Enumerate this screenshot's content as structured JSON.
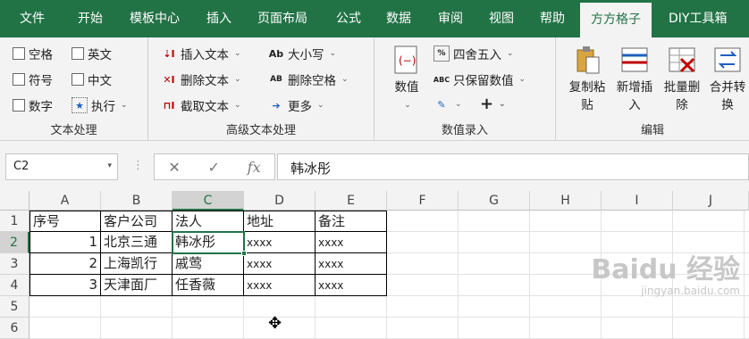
{
  "menu": {
    "tabs": [
      "文件",
      "开始",
      "模板中心",
      "插入",
      "页面布局",
      "公式",
      "数据",
      "审阅",
      "视图",
      "帮助",
      "方方格子",
      "DIY工具箱"
    ],
    "active": "方方格子"
  },
  "ribbon": {
    "text_group": {
      "label": "文本处理",
      "items": [
        "空格",
        "英文",
        "符号",
        "中文",
        "数字",
        "执行"
      ]
    },
    "advanced_group": {
      "label": "高级文本处理",
      "insert": "插入文本",
      "delete": "删除文本",
      "extract": "截取文本",
      "case": "大小写",
      "case_icon": "Ab",
      "del_space": "删除空格",
      "del_space_icon": "AB",
      "more": "更多"
    },
    "value_group": {
      "label": "数值录入",
      "value": "数值",
      "round": "四舍五入",
      "keep_value": "只保留数值",
      "keep_icon": "ABC",
      "plus": "+"
    },
    "edit_group": {
      "label": "编辑",
      "copy_paste": [
        "复制粘",
        "贴"
      ],
      "new_insert": [
        "新增插",
        "入"
      ],
      "batch_delete": [
        "批量删",
        "除"
      ],
      "merge": [
        "合并转",
        "换"
      ]
    }
  },
  "formula_bar": {
    "name_box": "C2",
    "fx": "fx",
    "value": "韩冰彤"
  },
  "grid": {
    "columns": [
      "A",
      "B",
      "C",
      "D",
      "E",
      "F",
      "G",
      "H",
      "I",
      "J"
    ],
    "rows": [
      "1",
      "2",
      "3",
      "4",
      "5",
      "6"
    ],
    "selected_col": "C",
    "selected_row": "2",
    "data": [
      [
        "序号",
        "客户公司",
        "法人",
        "地址",
        "备注"
      ],
      [
        "1",
        "北京三通",
        "韩冰彤",
        "xxxx",
        "xxxx"
      ],
      [
        "2",
        "上海凯行",
        "戚莺",
        "xxxx",
        "xxxx"
      ],
      [
        "3",
        "天津面厂",
        "任香薇",
        "xxxx",
        "xxxx"
      ]
    ]
  },
  "watermark": {
    "brand": "Baidu 经验",
    "url": "jingyan.baidu.com"
  },
  "colors": {
    "accent": "#217346",
    "ribbon_bg": "#f3f3f3"
  }
}
